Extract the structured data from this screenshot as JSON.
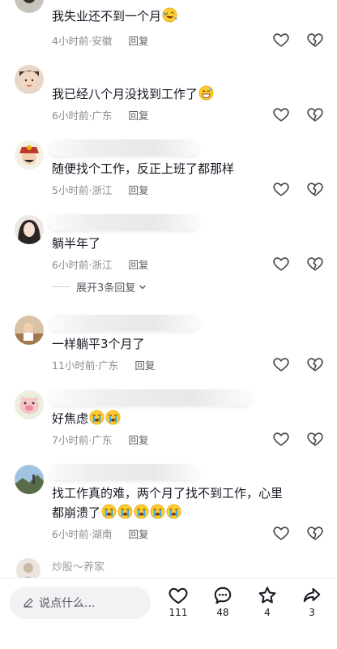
{
  "comments": [
    {
      "text": "我失业还不到一个月",
      "emoji": "rofl",
      "meta": "4小时前·安徽",
      "reply": "回复"
    },
    {
      "text": "我已经八个月没找到工作了",
      "emoji": "grin-sweat",
      "meta": "6小时前·广东",
      "reply": "回复"
    },
    {
      "text": "随便找个工作，反正上班了都那样",
      "emoji": "",
      "meta": "5小时前·浙江",
      "reply": "回复"
    },
    {
      "text": "躺半年了",
      "emoji": "",
      "meta": "6小时前·浙江",
      "reply": "回复"
    },
    {
      "text": "一样躺平3个月了",
      "emoji": "",
      "meta": "11小时前·广东",
      "reply": "回复"
    },
    {
      "text": "好焦虑",
      "emoji": "sob-x2",
      "meta": "7小时前·广东",
      "reply": "回复"
    },
    {
      "text": "找工作真的难，两个月了找不到工作，心里都崩溃了",
      "emoji": "sob-x5",
      "meta": "6小时前·湖南",
      "reply": "回复"
    }
  ],
  "expand_replies": "展开3条回复",
  "peek_comment": {
    "name": "炒股～养家"
  },
  "bottom_bar": {
    "input_placeholder": "说点什么...",
    "like_count": "111",
    "comment_count": "48",
    "favorite_count": "4",
    "share_count": "3"
  },
  "colors": {
    "text": "#161823",
    "meta": "#8a8b91",
    "icon": "#5a5b63"
  }
}
